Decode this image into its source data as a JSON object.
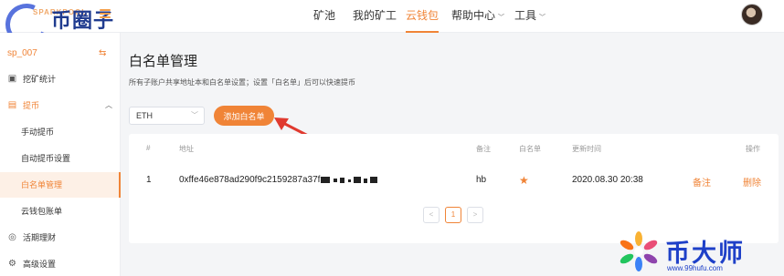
{
  "header": {
    "brand_small": "SPARKPOOL",
    "brand_big": "币圈子",
    "nav": [
      {
        "label": "矿池",
        "active": false,
        "dropdown": false
      },
      {
        "label": "我的矿工",
        "active": false,
        "dropdown": false
      },
      {
        "label": "云钱包",
        "active": true,
        "dropdown": false
      },
      {
        "label": "帮助中心",
        "active": false,
        "dropdown": true
      },
      {
        "label": "工具",
        "active": false,
        "dropdown": true
      }
    ]
  },
  "sidebar": {
    "account": "sp_007",
    "items": [
      {
        "label": "挖矿统计",
        "icon": "chart-icon"
      },
      {
        "label": "提币",
        "icon": "wallet-icon"
      },
      {
        "label": "手动提币"
      },
      {
        "label": "自动提币设置"
      },
      {
        "label": "白名单管理"
      },
      {
        "label": "云钱包账单"
      },
      {
        "label": "活期理财",
        "icon": "finance-icon"
      },
      {
        "label": "高级设置",
        "icon": "settings-icon"
      }
    ]
  },
  "main": {
    "title": "白名单管理",
    "description": "所有子账户共享地址本和白名单设置；设置「白名单」后可以快速提币",
    "coin_select": "ETH",
    "add_button": "添加白名单",
    "table": {
      "headers": [
        "#",
        "地址",
        "备注",
        "白名单",
        "更新时间",
        "操作"
      ],
      "rows": [
        {
          "index": "1",
          "address": "0xffe46e878ad290f9c2159287a37f",
          "remark": "hb",
          "whitelisted": true,
          "updated": "2020.08.30 20:38",
          "action_remark": "备注",
          "action_delete": "删除"
        }
      ]
    },
    "pagination": {
      "prev": "<",
      "current": "1",
      "next": ">"
    }
  },
  "watermark": {
    "text": "币大师",
    "url": "www.99hufu.com"
  },
  "colors": {
    "accent": "#f08437",
    "arrow": "#e03a2f"
  }
}
